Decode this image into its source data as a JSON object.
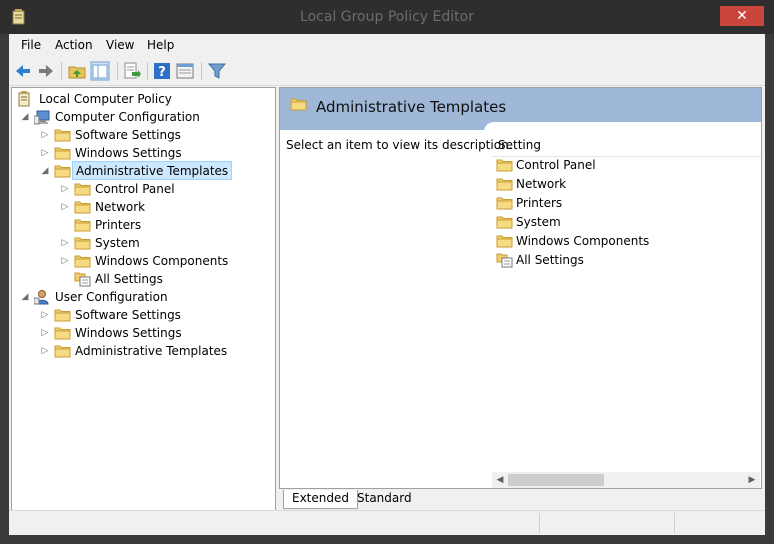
{
  "window": {
    "title": "Local Group Policy Editor",
    "close_glyph": "✕",
    "minimize_glyph": "—"
  },
  "menu": [
    {
      "label": "File"
    },
    {
      "label": "Action"
    },
    {
      "label": "View"
    },
    {
      "label": "Help"
    }
  ],
  "toolbar": {
    "tools": [
      "back-icon",
      "forward-icon",
      "up-folder-icon",
      "show-hide-tree-icon",
      "export-list-icon",
      "help-icon",
      "properties-icon",
      "filter-icon"
    ]
  },
  "tree": {
    "root": "Local Computer Policy",
    "computer": "Computer Configuration",
    "cc_software": "Software Settings",
    "cc_windows": "Windows Settings",
    "cc_admin": "Administrative Templates",
    "control_panel": "Control Panel",
    "network": "Network",
    "printers": "Printers",
    "system": "System",
    "windows_components": "Windows Components",
    "all_settings": "All Settings",
    "user": "User Configuration",
    "uc_software": "Software Settings",
    "uc_windows": "Windows Settings",
    "uc_admin": "Administrative Templates"
  },
  "details": {
    "header_title": "Administrative Templates",
    "description": "Select an item to view its description.",
    "column_header": "Setting",
    "items": [
      "Control Panel",
      "Network",
      "Printers",
      "System",
      "Windows Components",
      "All Settings"
    ]
  },
  "tabs": {
    "extended": "Extended",
    "standard": "Standard"
  },
  "colors": {
    "header_band": "#9fb8d8",
    "selection": "#cce8ff",
    "close_button": "#c9453b"
  }
}
